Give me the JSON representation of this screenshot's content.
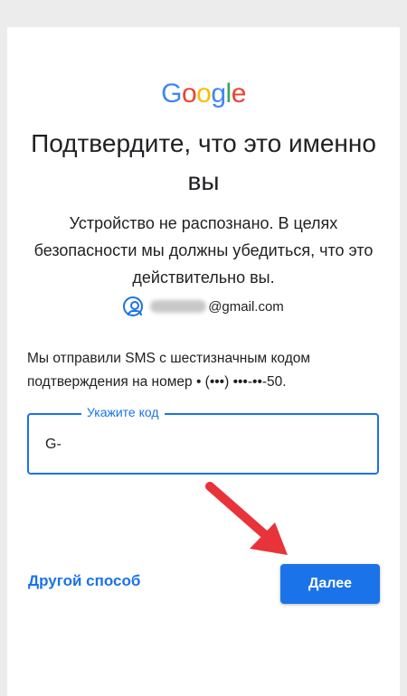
{
  "logo": {
    "letters": [
      "G",
      "o",
      "o",
      "g",
      "l",
      "e"
    ],
    "colors": [
      "#4285F4",
      "#EA4335",
      "#FBBC05",
      "#4285F4",
      "#34A853",
      "#EA4335"
    ]
  },
  "title": "Подтвердите, что это именно вы",
  "subtitle": "Устройство не распознано. В целях безопасности мы должны убедиться, что это действительно вы.",
  "account": {
    "email_domain": "@gmail.com"
  },
  "info_text": "Мы отправили SMS с шестизначным кодом подтверждения на номер • (•••) •••-••-50.",
  "code_field": {
    "label": "Укажите код",
    "value": "G-"
  },
  "other_way_label": "Другой способ",
  "next_button_label": "Далее",
  "accent_color": "#1a73e8",
  "annotation_arrow_color": "#e8333a"
}
